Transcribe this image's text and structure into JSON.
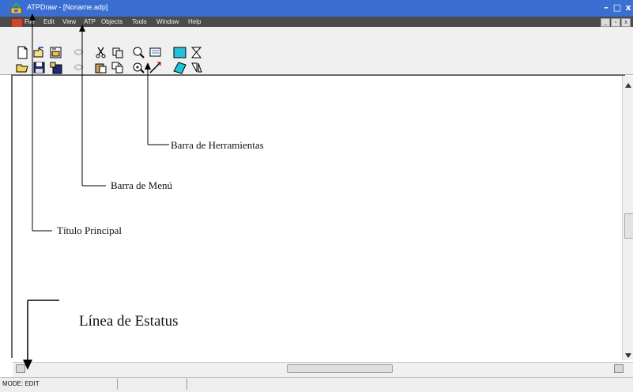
{
  "window": {
    "title": "ATPDraw - [Noname.adp]",
    "controls": {
      "minimize": "–",
      "maximize": "□",
      "close": "x"
    }
  },
  "menu": {
    "items": [
      "File",
      "Edit",
      "View",
      "ATP",
      "Objects",
      "Tools",
      "Window",
      "Help"
    ],
    "mdi_controls": {
      "minimize": "_",
      "restore": "▫",
      "close": "x"
    }
  },
  "toolbar": {
    "row1": [
      "new-icon",
      "open-project-icon",
      "save-project-icon",
      "undo-icon",
      "cut-icon",
      "copy-icon",
      "zoom-icon",
      "print-icon",
      "fill-rect-icon",
      "transform-icon"
    ],
    "row2": [
      "open-icon",
      "save-icon",
      "save-as-icon",
      "redo-icon",
      "paste-icon",
      "duplicate-icon",
      "zoom-fit-icon",
      "draw-line-icon",
      "rotate-icon",
      "flip-icon"
    ]
  },
  "status": {
    "mode": "MODE: EDIT"
  },
  "annotations": {
    "title": "Título Principal",
    "menu": "Barra de Menú",
    "toolbar": "Barra de Herramientas",
    "status": "Línea de Estatus"
  },
  "colors": {
    "titlebar": "#3a6fd1",
    "menubar": "#4b4b4b",
    "toolbar": "#f0f0f0"
  }
}
